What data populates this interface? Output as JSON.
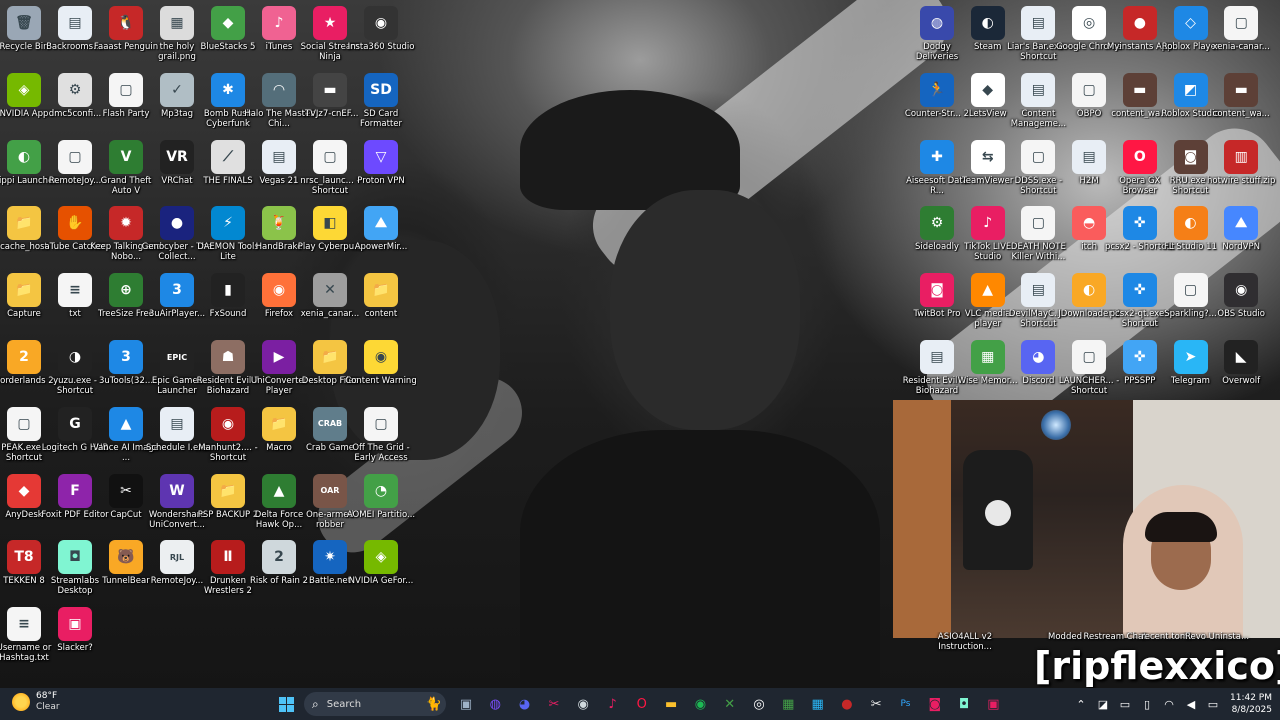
{
  "desktop": {
    "left_icons": [
      {
        "label": "Recycle Bin",
        "color": "#9aa7b5",
        "glyph": "🗑",
        "icon": "recycle-bin-icon"
      },
      {
        "label": "Backrooms....",
        "color": "#e8eef5",
        "glyph": "▤",
        "icon": "shortcut-file-icon"
      },
      {
        "label": "Faaast Penguin",
        "color": "#c62828",
        "glyph": "🐧",
        "icon": "penguin-icon"
      },
      {
        "label": "the holy grail.png",
        "color": "#dcdcdc",
        "glyph": "▦",
        "icon": "image-file-icon"
      },
      {
        "label": "BlueStacks 5",
        "color": "#43a047",
        "glyph": "◆",
        "icon": "bluestacks-icon"
      },
      {
        "label": "iTunes",
        "color": "#f06292",
        "glyph": "♪",
        "icon": "itunes-icon"
      },
      {
        "label": "Social Stream Ninja",
        "color": "#e91e63",
        "glyph": "★",
        "icon": "ninja-icon"
      },
      {
        "label": "Insta360 Studio",
        "color": "#333333",
        "glyph": "◉",
        "icon": "insta360-icon"
      },
      {
        "label": "NVIDIA App",
        "color": "#76b900",
        "glyph": "◈",
        "icon": "nvidia-icon"
      },
      {
        "label": "dmc5confi...",
        "color": "#e0e0e0",
        "glyph": "⚙",
        "icon": "config-file-icon"
      },
      {
        "label": "Flash Party",
        "color": "#f5f5f5",
        "glyph": "▢",
        "icon": "blank-file-icon"
      },
      {
        "label": "Mp3tag",
        "color": "#b0bec5",
        "glyph": "✓",
        "icon": "mp3tag-icon"
      },
      {
        "label": "Bomb Rush Cyberfunk",
        "color": "#1e88e5",
        "glyph": "✱",
        "icon": "game-icon"
      },
      {
        "label": "Halo The Master Chi...",
        "color": "#546e7a",
        "glyph": "◠",
        "icon": "halo-icon"
      },
      {
        "label": "tTVJz7-cnEF...",
        "color": "#444444",
        "glyph": "▬",
        "icon": "video-file-icon"
      },
      {
        "label": "SD Card Formatter",
        "color": "#1565c0",
        "glyph": "SD",
        "icon": "sd-card-icon"
      },
      {
        "label": "Slippi Launcher",
        "color": "#43a047",
        "glyph": "◐",
        "icon": "slippi-icon"
      },
      {
        "label": "RemoteJoy...",
        "color": "#f5f5f5",
        "glyph": "▢",
        "icon": "blank-file-icon"
      },
      {
        "label": "Grand Theft Auto V",
        "color": "#2e7d32",
        "glyph": "V",
        "icon": "gta-icon"
      },
      {
        "label": "VRChat",
        "color": "#222222",
        "glyph": "VR",
        "icon": "vrchat-icon"
      },
      {
        "label": "THE FINALS",
        "color": "#e0e0e0",
        "glyph": "⟋",
        "icon": "finals-icon"
      },
      {
        "label": "Vegas 21",
        "color": "#e8eef5",
        "glyph": "▤",
        "icon": "vegas-icon"
      },
      {
        "label": "nrsc_launc... - Shortcut",
        "color": "#f5f5f5",
        "glyph": "▢",
        "icon": "blank-file-icon"
      },
      {
        "label": "Proton VPN",
        "color": "#6d4aff",
        "glyph": "▽",
        "icon": "proton-vpn-icon"
      },
      {
        "label": "cache_host",
        "color": "#f4c542",
        "glyph": "📁",
        "icon": "folder-icon"
      },
      {
        "label": "aTube Catcher",
        "color": "#e65100",
        "glyph": "✋",
        "icon": "atube-icon"
      },
      {
        "label": "Keep Talking and Nobo...",
        "color": "#c62828",
        "glyph": "✹",
        "icon": "bomb-icon"
      },
      {
        "label": "Genocyber - The Collect...",
        "color": "#1a237e",
        "glyph": "●",
        "icon": "disc-icon"
      },
      {
        "label": "DAEMON Tools Lite",
        "color": "#0288d1",
        "glyph": "⚡",
        "icon": "daemon-icon"
      },
      {
        "label": "HandBrake",
        "color": "#8bc34a",
        "glyph": "🍹",
        "icon": "handbrake-icon"
      },
      {
        "label": "Play Cyberpu...",
        "color": "#fdd835",
        "glyph": "◧",
        "icon": "cyberpunk-icon"
      },
      {
        "label": "ApowerMir...",
        "color": "#42a5f5",
        "glyph": "⛰",
        "icon": "apowermirror-icon"
      },
      {
        "label": "Capture",
        "color": "#f4c542",
        "glyph": "📁",
        "icon": "folder-icon"
      },
      {
        "label": "txt",
        "color": "#f5f5f5",
        "glyph": "≡",
        "icon": "text-file-icon"
      },
      {
        "label": "TreeSize Free",
        "color": "#2e7d32",
        "glyph": "⊕",
        "icon": "treesize-icon"
      },
      {
        "label": "3uAirPlayer...",
        "color": "#1e88e5",
        "glyph": "3",
        "icon": "3u-icon"
      },
      {
        "label": "FxSound",
        "color": "#222222",
        "glyph": "▮",
        "icon": "fxsound-icon"
      },
      {
        "label": "Firefox",
        "color": "#ff7139",
        "glyph": "◉",
        "icon": "firefox-icon"
      },
      {
        "label": "xenia_canar...",
        "color": "#9e9e9e",
        "glyph": "✕",
        "icon": "xenia-icon"
      },
      {
        "label": "content",
        "color": "#f4c542",
        "glyph": "📁",
        "icon": "folder-icon"
      },
      {
        "label": "Borderlands 2",
        "color": "#f9a825",
        "glyph": "2",
        "icon": "borderlands-icon"
      },
      {
        "label": "yuzu.exe - Shortcut",
        "color": "#222222",
        "glyph": "◑",
        "icon": "yuzu-icon"
      },
      {
        "label": "3uTools(32...",
        "color": "#1e88e5",
        "glyph": "3",
        "icon": "3utools-icon"
      },
      {
        "label": "Epic Games Launcher",
        "color": "#222222",
        "glyph": "EPIC",
        "icon": "epic-icon"
      },
      {
        "label": "Resident Evil 7 Biohazard",
        "color": "#8d6e63",
        "glyph": "☗",
        "icon": "re7-icon"
      },
      {
        "label": "UniConverter Player",
        "color": "#7b1fa2",
        "glyph": "▶",
        "icon": "uniconverter-icon"
      },
      {
        "label": "Desktop Files",
        "color": "#f4c542",
        "glyph": "📁",
        "icon": "folder-icon"
      },
      {
        "label": "Content Warning",
        "color": "#fdd835",
        "glyph": "◉",
        "icon": "content-warning-icon"
      },
      {
        "label": "PEAK.exe - Shortcut",
        "color": "#f5f5f5",
        "glyph": "▢",
        "icon": "blank-file-icon"
      },
      {
        "label": "Logitech G HUB",
        "color": "#222222",
        "glyph": "G",
        "icon": "logitech-icon"
      },
      {
        "label": "Vance AI Image ...",
        "color": "#1e88e5",
        "glyph": "▲",
        "icon": "vance-icon"
      },
      {
        "label": "Schedule I.exe",
        "color": "#e8eef5",
        "glyph": "▤",
        "icon": "shortcut-file-icon"
      },
      {
        "label": "Manhunt2.... - Shortcut",
        "color": "#b71c1c",
        "glyph": "◉",
        "icon": "manhunt-icon"
      },
      {
        "label": "Macro",
        "color": "#f4c542",
        "glyph": "📁",
        "icon": "folder-icon"
      },
      {
        "label": "Crab Game",
        "color": "#607d8b",
        "glyph": "CRAB",
        "icon": "crab-game-icon"
      },
      {
        "label": "Off The Grid - Early Access",
        "color": "#f5f5f5",
        "glyph": "▢",
        "icon": "blank-file-icon"
      },
      {
        "label": "AnyDesk",
        "color": "#e53935",
        "glyph": "◆",
        "icon": "anydesk-icon"
      },
      {
        "label": "Foxit PDF Editor",
        "color": "#8e24aa",
        "glyph": "F",
        "icon": "foxit-icon"
      },
      {
        "label": "CapCut",
        "color": "#111111",
        "glyph": "✂",
        "icon": "capcut-icon"
      },
      {
        "label": "Wondershare UniConvert...",
        "color": "#5e35b1",
        "glyph": "W",
        "icon": "wondershare-icon"
      },
      {
        "label": "PSP BACKUP 2",
        "color": "#f4c542",
        "glyph": "📁",
        "icon": "folder-icon"
      },
      {
        "label": "Delta Force Hawk Op...",
        "color": "#2e7d32",
        "glyph": "▲",
        "icon": "delta-force-icon"
      },
      {
        "label": "One-armed robber",
        "color": "#795548",
        "glyph": "OAR",
        "icon": "robber-icon"
      },
      {
        "label": "AOMEI Partitio...",
        "color": "#43a047",
        "glyph": "◔",
        "icon": "aomei-icon"
      },
      {
        "label": "TEKKEN 8",
        "color": "#c62828",
        "glyph": "T8",
        "icon": "tekken-icon"
      },
      {
        "label": "Streamlabs Desktop",
        "color": "#80f5d2",
        "glyph": "◘",
        "icon": "streamlabs-icon"
      },
      {
        "label": "TunnelBear",
        "color": "#f9a825",
        "glyph": "🐻",
        "icon": "tunnelbear-icon"
      },
      {
        "label": "RemoteJoy...",
        "color": "#eceff1",
        "glyph": "RJL",
        "icon": "remotejoy-icon"
      },
      {
        "label": "Drunken Wrestlers 2",
        "color": "#b71c1c",
        "glyph": "Ⅱ",
        "icon": "wrestlers-icon"
      },
      {
        "label": "Risk of Rain 2",
        "color": "#cfd8dc",
        "glyph": "2",
        "icon": "risk-of-rain-icon"
      },
      {
        "label": "Battle.net",
        "color": "#1565c0",
        "glyph": "✷",
        "icon": "battlenet-icon"
      },
      {
        "label": "NVIDIA GeFor...",
        "color": "#76b900",
        "glyph": "◈",
        "icon": "geforce-icon"
      },
      {
        "label": "Username or Hashtag.txt",
        "color": "#f5f5f5",
        "glyph": "≡",
        "icon": "text-file-icon"
      },
      {
        "label": "Slacker?",
        "color": "#e91e63",
        "glyph": "▣",
        "icon": "slacker-icon"
      }
    ],
    "right_icons": [
      {
        "label": "Dodgy Deliveries",
        "color": "#3949ab",
        "glyph": "◍",
        "icon": "dodgy-icon"
      },
      {
        "label": "Steam",
        "color": "#1b2838",
        "glyph": "◐",
        "icon": "steam-icon"
      },
      {
        "label": "Liar's Bar.exe - Shortcut",
        "color": "#e8eef5",
        "glyph": "▤",
        "icon": "shortcut-file-icon"
      },
      {
        "label": "Google Chrome",
        "color": "#ffffff",
        "glyph": "◎",
        "icon": "chrome-icon"
      },
      {
        "label": "Myinstants App",
        "color": "#c62828",
        "glyph": "●",
        "icon": "myinstants-icon"
      },
      {
        "label": "Roblox Player",
        "color": "#1e88e5",
        "glyph": "◇",
        "icon": "roblox-icon"
      },
      {
        "label": "xenia-canar...",
        "color": "#f5f5f5",
        "glyph": "▢",
        "icon": "blank-file-icon"
      },
      {
        "label": "Counter-Str... 2",
        "color": "#1565c0",
        "glyph": "🏃",
        "icon": "cs2-icon"
      },
      {
        "label": "LetsView",
        "color": "#ffffff",
        "glyph": "◆",
        "icon": "letsview-icon"
      },
      {
        "label": "Content Manageme...",
        "color": "#e8eef5",
        "glyph": "▤",
        "icon": "shortcut-file-icon"
      },
      {
        "label": "OBPO",
        "color": "#f5f5f5",
        "glyph": "▢",
        "icon": "blank-file-icon"
      },
      {
        "label": "content_wa...",
        "color": "#5d4037",
        "glyph": "▬",
        "icon": "video-file-icon"
      },
      {
        "label": "Roblox Studio",
        "color": "#1e88e5",
        "glyph": "◩",
        "icon": "roblox-studio-icon"
      },
      {
        "label": "content_wa...",
        "color": "#5d4037",
        "glyph": "▬",
        "icon": "video-file-icon"
      },
      {
        "label": "Aiseesoft Data R...",
        "color": "#1e88e5",
        "glyph": "✚",
        "icon": "aiseesoft-icon"
      },
      {
        "label": "TeamViewer",
        "color": "#ffffff",
        "glyph": "⇆",
        "icon": "teamviewer-icon"
      },
      {
        "label": "DDSS.exe - Shortcut",
        "color": "#f5f5f5",
        "glyph": "▢",
        "icon": "blank-file-icon"
      },
      {
        "label": "H2M",
        "color": "#e8eef5",
        "glyph": "▤",
        "icon": "shortcut-file-icon"
      },
      {
        "label": "Opera GX Browser",
        "color": "#ff1744",
        "glyph": "O",
        "icon": "opera-gx-icon"
      },
      {
        "label": "RRU.exe - Shortcut",
        "color": "#5d4037",
        "glyph": "◙",
        "icon": "rru-icon"
      },
      {
        "label": "hotwire stuff.zip",
        "color": "#c62828",
        "glyph": "▥",
        "icon": "winrar-icon"
      },
      {
        "label": "Sideloadly",
        "color": "#2e7d32",
        "glyph": "⚙",
        "icon": "sideloadly-icon"
      },
      {
        "label": "TikTok LIVE Studio",
        "color": "#e91e63",
        "glyph": "♪",
        "icon": "tiktok-icon"
      },
      {
        "label": "DEATH NOTE Killer Withi...",
        "color": "#f5f5f5",
        "glyph": "▢",
        "icon": "blank-file-icon"
      },
      {
        "label": "itch",
        "color": "#fa5c5c",
        "glyph": "◓",
        "icon": "itch-icon"
      },
      {
        "label": "pcsx2 - Shortcut",
        "color": "#1e88e5",
        "glyph": "✜",
        "icon": "pcsx2-icon"
      },
      {
        "label": "FL Studio 11",
        "color": "#f57f17",
        "glyph": "◐",
        "icon": "fl-studio-icon"
      },
      {
        "label": "NordVPN",
        "color": "#4687ff",
        "glyph": "⛰",
        "icon": "nordvpn-icon"
      },
      {
        "label": "TwitBot Pro",
        "color": "#e91e63",
        "glyph": "◙",
        "icon": "twitbot-icon"
      },
      {
        "label": "VLC media player",
        "color": "#ff8800",
        "glyph": "▲",
        "icon": "vlc-icon"
      },
      {
        "label": "DevilMayC... - Shortcut",
        "color": "#e8eef5",
        "glyph": "▤",
        "icon": "shortcut-file-icon"
      },
      {
        "label": "JDownloader 2",
        "color": "#f9a825",
        "glyph": "◐",
        "icon": "jdownloader-icon"
      },
      {
        "label": "pcsx2-qt.exe - Shortcut",
        "color": "#1e88e5",
        "glyph": "✜",
        "icon": "pcsx2-icon"
      },
      {
        "label": "Sparkling?...",
        "color": "#f5f5f5",
        "glyph": "▢",
        "icon": "blank-file-icon"
      },
      {
        "label": "OBS Studio",
        "color": "#302e31",
        "glyph": "◉",
        "icon": "obs-icon"
      },
      {
        "label": "Resident Evil 7 - Biohazard",
        "color": "#e8eef5",
        "glyph": "▤",
        "icon": "shortcut-file-icon"
      },
      {
        "label": "Wise Memor...",
        "color": "#43a047",
        "glyph": "▦",
        "icon": "wise-memory-icon"
      },
      {
        "label": "Discord",
        "color": "#5865f2",
        "glyph": "◕",
        "icon": "discord-icon"
      },
      {
        "label": "LAUNCHER... - Shortcut",
        "color": "#f5f5f5",
        "glyph": "▢",
        "icon": "blank-file-icon"
      },
      {
        "label": "PPSSPP",
        "color": "#42a5f5",
        "glyph": "✜",
        "icon": "ppsspp-icon"
      },
      {
        "label": "Telegram",
        "color": "#29b6f6",
        "glyph": "➤",
        "icon": "telegram-icon"
      },
      {
        "label": "Overwolf",
        "color": "#222222",
        "glyph": "◣",
        "icon": "overwolf-icon"
      }
    ],
    "bottom_labels": [
      "ASIO4ALL v2 Instruction...",
      "Modded",
      "Restream Chat",
      "recent.tomi",
      "Revo Uninsta..."
    ]
  },
  "overlay": {
    "watermark": "[ripflexxico]"
  },
  "taskbar": {
    "weather_temp": "68°F",
    "weather_desc": "Clear",
    "search_placeholder": "Search",
    "pinned": [
      {
        "name": "task-view-icon",
        "glyph": "▣",
        "color": "#9fb3c8"
      },
      {
        "name": "copilot-icon",
        "glyph": "◍",
        "color": "#7c4dff"
      },
      {
        "name": "discord-taskbar-icon",
        "glyph": "◕",
        "color": "#5865f2"
      },
      {
        "name": "snipping-tool-icon",
        "glyph": "✂",
        "color": "#e91e63"
      },
      {
        "name": "obs-taskbar-icon",
        "glyph": "◉",
        "color": "#cfd8dc"
      },
      {
        "name": "tiktok-taskbar-icon",
        "glyph": "♪",
        "color": "#e91e63"
      },
      {
        "name": "opera-gx-taskbar-icon",
        "glyph": "O",
        "color": "#ff1744"
      },
      {
        "name": "file-explorer-icon",
        "glyph": "▬",
        "color": "#fbc02d"
      },
      {
        "name": "spotify-icon",
        "glyph": "◉",
        "color": "#1db954"
      },
      {
        "name": "xbox-icon",
        "glyph": "✕",
        "color": "#43a047"
      },
      {
        "name": "chrome-taskbar-icon",
        "glyph": "◎",
        "color": "#ffffff"
      },
      {
        "name": "app-taskbar-icon-1",
        "glyph": "▦",
        "color": "#43a047"
      },
      {
        "name": "app-taskbar-icon-2",
        "glyph": "▦",
        "color": "#29b6f6"
      },
      {
        "name": "myinstants-taskbar-icon",
        "glyph": "●",
        "color": "#c62828"
      },
      {
        "name": "capcut-taskbar-icon",
        "glyph": "✂",
        "color": "#eeeeee"
      },
      {
        "name": "photoshop-icon",
        "glyph": "Ps",
        "color": "#31a8ff"
      },
      {
        "name": "twitbot-taskbar-icon",
        "glyph": "◙",
        "color": "#e91e63"
      },
      {
        "name": "streamlabs-taskbar-icon",
        "glyph": "◘",
        "color": "#80f5d2"
      },
      {
        "name": "app-taskbar-icon-3",
        "glyph": "▣",
        "color": "#e91e63"
      }
    ],
    "time": "11:42 PM",
    "date": "8/8/2025"
  }
}
